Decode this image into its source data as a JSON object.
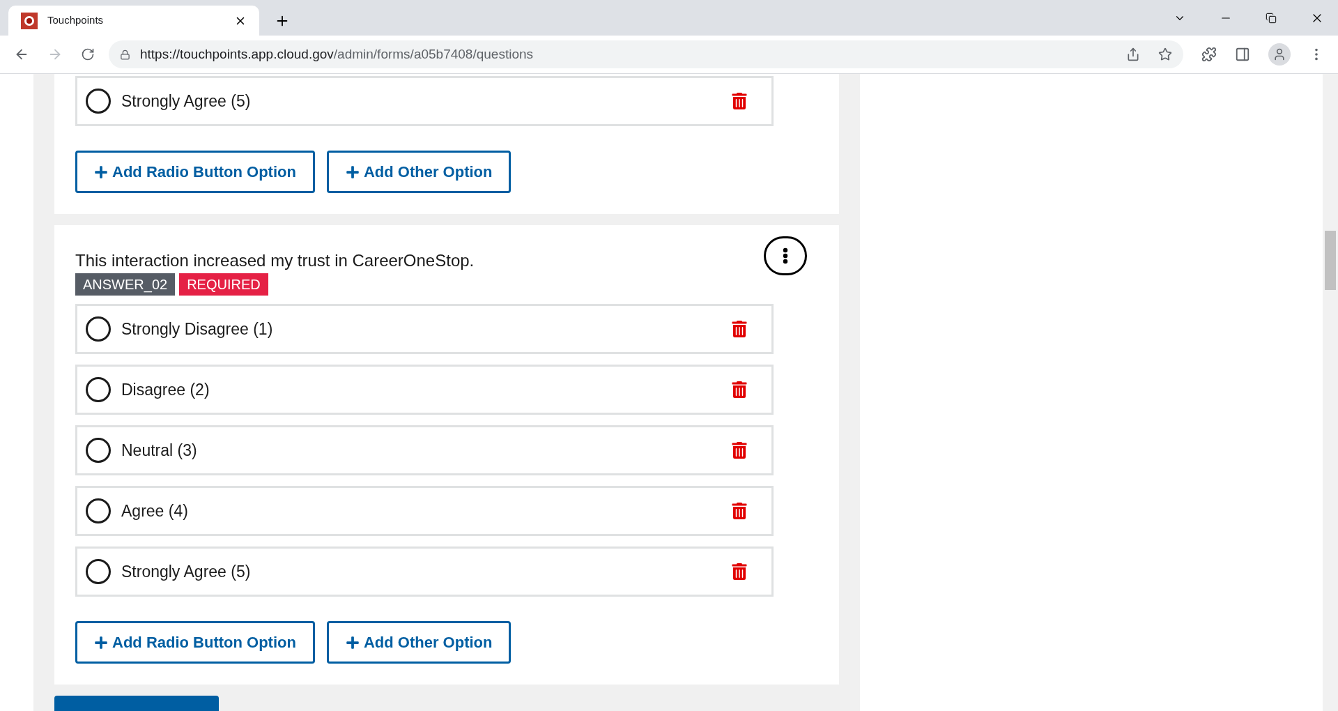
{
  "browser": {
    "tab_title": "Touchpoints",
    "url_host": "https://touchpoints.app.cloud.gov",
    "url_path": "/admin/forms/a05b7408/questions"
  },
  "questions": [
    {
      "options": [
        "Strongly Agree (5)"
      ],
      "buttons": [
        "Add Radio Button Option",
        "Add Other Option"
      ]
    },
    {
      "text": "This interaction increased my trust in CareerOneStop.",
      "tags": [
        {
          "label": "ANSWER_02",
          "kind": "id"
        },
        {
          "label": "REQUIRED",
          "kind": "required"
        }
      ],
      "options": [
        "Strongly Disagree (1)",
        "Disagree (2)",
        "Neutral (3)",
        "Agree (4)",
        "Strongly Agree (5)"
      ],
      "buttons": [
        "Add Radio Button Option",
        "Add Other Option"
      ]
    }
  ]
}
